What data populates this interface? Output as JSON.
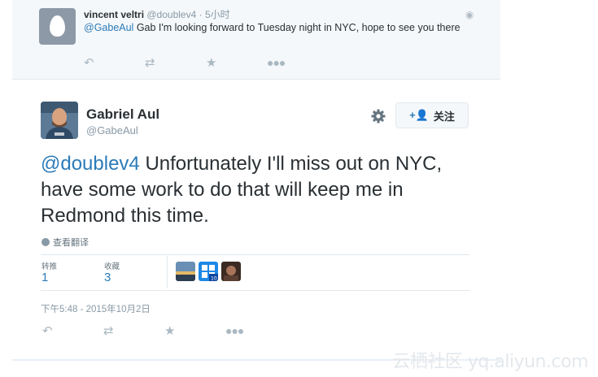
{
  "reply": {
    "name": "vincent veltri",
    "handle": "@doublev4",
    "separator": "·",
    "time": "5小时",
    "mention": "@GabeAul",
    "text": " Gab I'm looking forward to Tuesday night in NYC, hope to see you there"
  },
  "tweet": {
    "name": "Gabriel Aul",
    "handle": "@GabeAul",
    "follow_label": "关注",
    "mention": "@doublev4",
    "text": " Unfortunately I'll miss out on NYC, have some work to do that will keep me in Redmond this time.",
    "translate_label": "查看翻译",
    "stats": {
      "retweets_label": "转推",
      "retweets_value": "1",
      "likes_label": "收藏",
      "likes_value": "3"
    },
    "timestamp": "下午5:48 - 2015年10月2日"
  },
  "watermark": "云栖社区 yq.aliyun.com",
  "colors": {
    "link": "#2b7bb9",
    "muted": "#8899a6",
    "action_icon": "#aab8c2"
  },
  "icons": [
    "reply-icon",
    "retweet-icon",
    "like-icon",
    "more-icon",
    "gear-icon",
    "add-user-icon",
    "globe-icon",
    "egg-avatar-icon"
  ]
}
